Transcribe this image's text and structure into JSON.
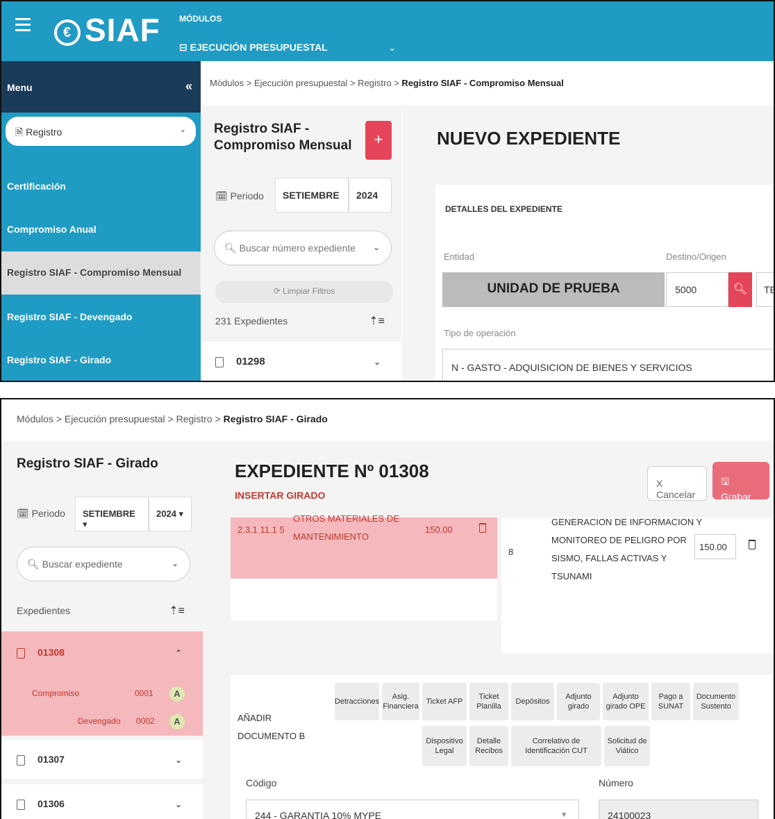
{
  "header": {
    "logo": "SIAF",
    "modules_label": "MÓDULOS",
    "module_selected": "EJECUCIÓN PRESUPUESTAL"
  },
  "sidebar": {
    "menu_label": "Menu",
    "collapse": "«",
    "section_select": "Registro",
    "items": [
      {
        "label": "Certificación"
      },
      {
        "label": "Compromiso Anual"
      },
      {
        "label": "Registro SIAF - Compromiso Mensual"
      },
      {
        "label": "Registro SIAF - Devengado"
      },
      {
        "label": "Registro SIAF - Girado"
      }
    ]
  },
  "panel1": {
    "breadcrumb_prefix": "Módulos > Ejecución presupuestal > Registro > ",
    "breadcrumb_current": "Registro SIAF - Compromiso Mensual",
    "list_title": "Registro SIAF - Compromiso Mensual",
    "add_label": "+",
    "periodo_label": "Periodo",
    "month": "SETIEMBRE",
    "year": "2024",
    "search_placeholder": "Buscar número expediente",
    "clear_filters": "Limpiar Filtros",
    "count_label": "231 Expedientes",
    "first_expediente": "01298",
    "form_title": "NUEVO EXPEDIENTE",
    "section_title": "DETALLES DEL EXPEDIENTE",
    "entidad_label": "Entidad",
    "entidad_value": "UNIDAD DE PRUEBA",
    "destino_label": "Destino/Origen",
    "destino_value": "5000",
    "destino_extra": "TES",
    "tipo_label": "Tipo de operación",
    "tipo_value": "N - GASTO - ADQUISICION DE BIENES Y SERVICIOS"
  },
  "panel2": {
    "breadcrumb_prefix": "Módulos > Ejecución presupuestal > Registro > ",
    "breadcrumb_current": "Registro SIAF - Girado",
    "list_title": "Registro SIAF - Girado",
    "periodo_label": "Periodo",
    "month": "SETIEMBRE",
    "year": "2024",
    "search_placeholder": "Buscar expediente",
    "count_label": "Expedientes",
    "rows": [
      {
        "num": "01308"
      },
      {
        "num": "01307"
      },
      {
        "num": "01306"
      }
    ],
    "sub": [
      {
        "label": "Compromiso",
        "code": "0001",
        "badge": "A"
      },
      {
        "label": "Devengado",
        "code": "0002",
        "badge": "A"
      }
    ],
    "title": "EXPEDIENTE Nº 01308",
    "subtitle": "INSERTAR GIRADO",
    "cancel": "X Cancelar",
    "save": "Grabar",
    "item_code": "2.3.1 11.1 5",
    "item_name_1": "OTROS MATERIALES DE",
    "item_name_2": "MANTENIMIENTO",
    "item_amount": "150.00",
    "meta_number": "8",
    "meta_lines": [
      "GENERACION DE INFORMACION Y",
      "MONITOREO DE PELIGRO POR",
      "SISMO, FALLAS ACTIVAS Y",
      "TSUNAMI"
    ],
    "meta_amount": "150.00",
    "add_doc_1": "AÑADIR",
    "add_doc_2": "DOCUMENTO B",
    "tags": [
      "Detracciones",
      "Asig. Financiera",
      "Ticket AFP",
      "Ticket Planilla",
      "Depósitos",
      "Adjunto girado",
      "Adjunto girado OPE",
      "Pago a SUNAT",
      "Documento Sustento",
      "Dispositivo Legal",
      "Detalle Recibos",
      "Correlativo de Identificación CUT",
      "Solicitud de Viático"
    ],
    "codigo_label": "Código",
    "codigo_value": "244 - GARANTIA 10% MYPE",
    "numero_label": "Número",
    "numero_value": "24100023"
  }
}
